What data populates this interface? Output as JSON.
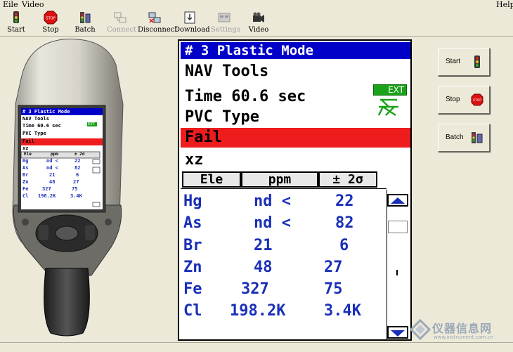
{
  "menu": {
    "file": "Eile",
    "video": "Video",
    "help": "Help"
  },
  "toolbar": {
    "start": "Start",
    "stop": "Stop",
    "batch": "Batch",
    "connect": "Connect",
    "disconnect": "Disconnect",
    "download": "Download",
    "settings": "Settings",
    "video": "Video"
  },
  "device_screen": {
    "title": "# 3 Plastic Mode",
    "tools": "NAV Tools",
    "time": "Time 60.6 sec",
    "type": "PVC Type",
    "result": "Fail",
    "xz": "xz",
    "ext": "EXT",
    "headers": [
      "Ele",
      "ppm",
      "± 2σ"
    ],
    "rows": [
      [
        "Hg",
        "nd <",
        "22"
      ],
      [
        "As",
        "nd <",
        "82"
      ],
      [
        "Br",
        "21",
        "6"
      ],
      [
        "Zn",
        "48",
        "27"
      ],
      [
        "Fe",
        "327",
        "75"
      ],
      [
        "Cl",
        "198.2K",
        "3.4K"
      ]
    ]
  },
  "display": {
    "title": "# 3 Plastic Mode",
    "tools": "NAV Tools",
    "time": "Time 60.6 sec",
    "type": "PVC Type",
    "result": "Fail",
    "xz": "xz",
    "ext": "EXT",
    "headers": {
      "ele": "Ele",
      "ppm": "ppm",
      "err": "± 2σ"
    },
    "rows": [
      {
        "ele": "Hg",
        "ppm": "nd <",
        "err": "22"
      },
      {
        "ele": "As",
        "ppm": "nd <",
        "err": "82"
      },
      {
        "ele": "Br",
        "ppm": "21",
        "err": "6"
      },
      {
        "ele": "Zn",
        "ppm": "48",
        "err": "27"
      },
      {
        "ele": "Fe",
        "ppm": "327",
        "err": "75"
      },
      {
        "ele": "Cl",
        "ppm": "198.2K",
        "err": "3.4K"
      }
    ]
  },
  "side_buttons": {
    "start": "Start",
    "stop": "Stop",
    "batch": "Batch"
  },
  "watermark": {
    "text": "仪器信息网",
    "url": "www.instrument.com.cn"
  },
  "colors": {
    "title_bar": "#0000c8",
    "fail": "#ee1c1c",
    "values": "#1a2fb8",
    "ext": "#1aa21a"
  }
}
